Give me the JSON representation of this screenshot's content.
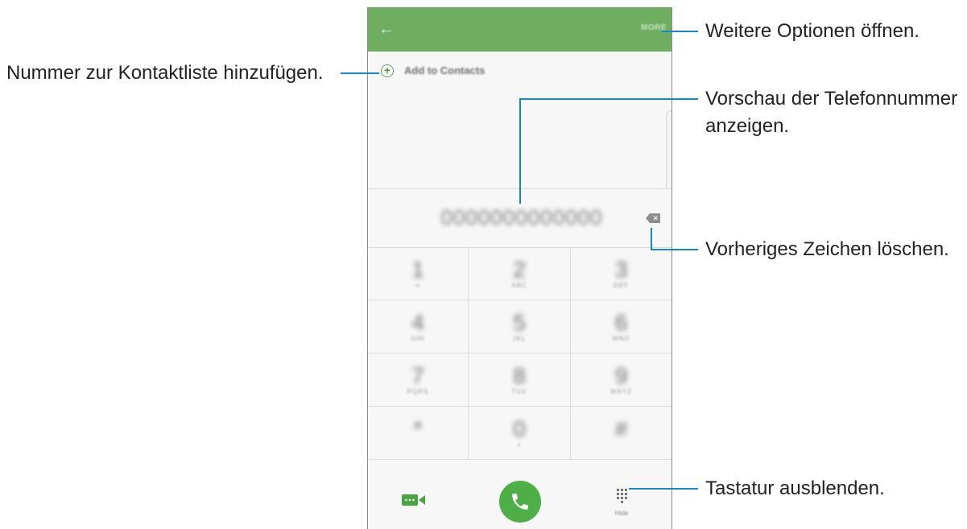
{
  "phone": {
    "appbar": {
      "back_icon": "arrow-left-icon",
      "more_label": "MORE",
      "color": "#6fae61"
    },
    "add_contacts": {
      "icon": "plus-circle-icon",
      "label": "Add to Contacts"
    },
    "number_preview": {
      "value": "0000000000000"
    },
    "delete_icon": "backspace-icon",
    "keypad": [
      {
        "digit": "1",
        "sub": "∞"
      },
      {
        "digit": "2",
        "sub": "ABC"
      },
      {
        "digit": "3",
        "sub": "DEF"
      },
      {
        "digit": "4",
        "sub": "GHI"
      },
      {
        "digit": "5",
        "sub": "JKL"
      },
      {
        "digit": "6",
        "sub": "MNO"
      },
      {
        "digit": "7",
        "sub": "PQRS"
      },
      {
        "digit": "8",
        "sub": "TUV"
      },
      {
        "digit": "9",
        "sub": "WXYZ"
      },
      {
        "digit": "*",
        "sub": ""
      },
      {
        "digit": "0",
        "sub": "+"
      },
      {
        "digit": "#",
        "sub": ""
      }
    ],
    "bottom": {
      "video_icon": "video-call-icon",
      "call_icon": "phone-icon",
      "call_color": "#4daf45",
      "hide_icon": "keypad-icon",
      "hide_label": "Hide"
    }
  },
  "callouts": {
    "more_options": "Weitere Optionen öffnen.",
    "add_contact": "Nummer zur Kontaktliste hinzufügen.",
    "preview_line1": "Vorschau der Telefonnummer",
    "preview_line2": "anzeigen.",
    "delete_char": "Vorheriges Zeichen löschen.",
    "hide_keypad": "Tastatur ausblenden.",
    "line_color": "#1488c6"
  }
}
